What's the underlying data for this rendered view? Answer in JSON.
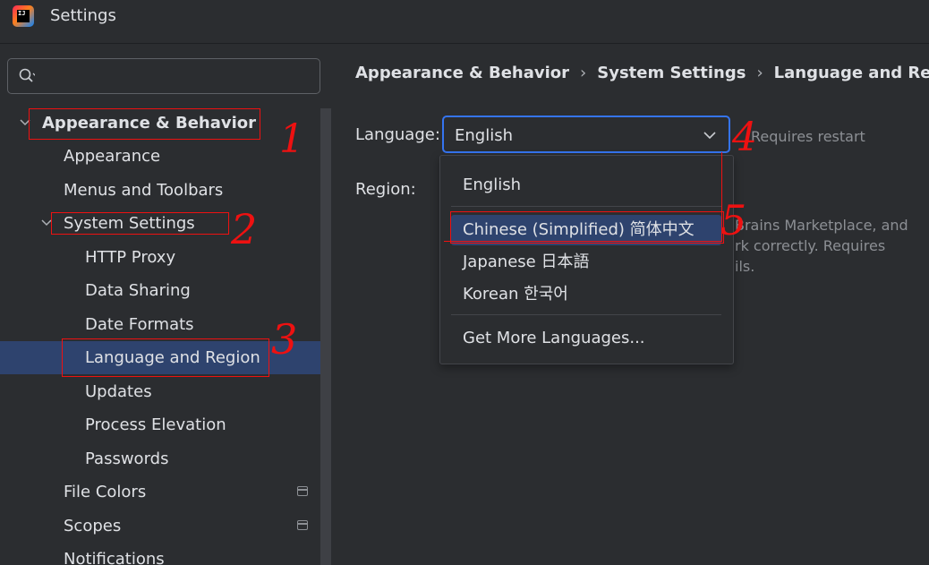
{
  "window": {
    "title": "Settings",
    "app_icon_text": "IJ"
  },
  "search": {
    "placeholder": "",
    "value": ""
  },
  "tree": {
    "appearance_behavior": "Appearance & Behavior",
    "appearance": "Appearance",
    "menus_toolbars": "Menus and Toolbars",
    "system_settings": "System Settings",
    "http_proxy": "HTTP Proxy",
    "data_sharing": "Data Sharing",
    "date_formats": "Date Formats",
    "language_region": "Language and Region",
    "updates": "Updates",
    "process_elevation": "Process Elevation",
    "passwords": "Passwords",
    "file_colors": "File Colors",
    "scopes": "Scopes",
    "notifications": "Notifications"
  },
  "breadcrumb": [
    "Appearance & Behavior",
    "System Settings",
    "Language and Region"
  ],
  "language": {
    "label": "Language:",
    "value": "English",
    "hint": "Requires restart"
  },
  "region": {
    "label": "Region:",
    "hint_lines": [
      "Brains Marketplace, and",
      "rk correctly. Requires",
      "ils."
    ]
  },
  "dropdown": {
    "options": [
      "English",
      "Chinese (Simplified) 简体中文",
      "Japanese 日本語",
      "Korean 한국어"
    ],
    "more": "Get More Languages..."
  },
  "annotations": {
    "n1": "1",
    "n2": "2",
    "n3": "3",
    "n4": "4",
    "n5": "5"
  },
  "colors": {
    "background": "#2b2d30",
    "selection": "#2e436e",
    "focus_border": "#3574f0",
    "annotation": "#ee1111"
  }
}
